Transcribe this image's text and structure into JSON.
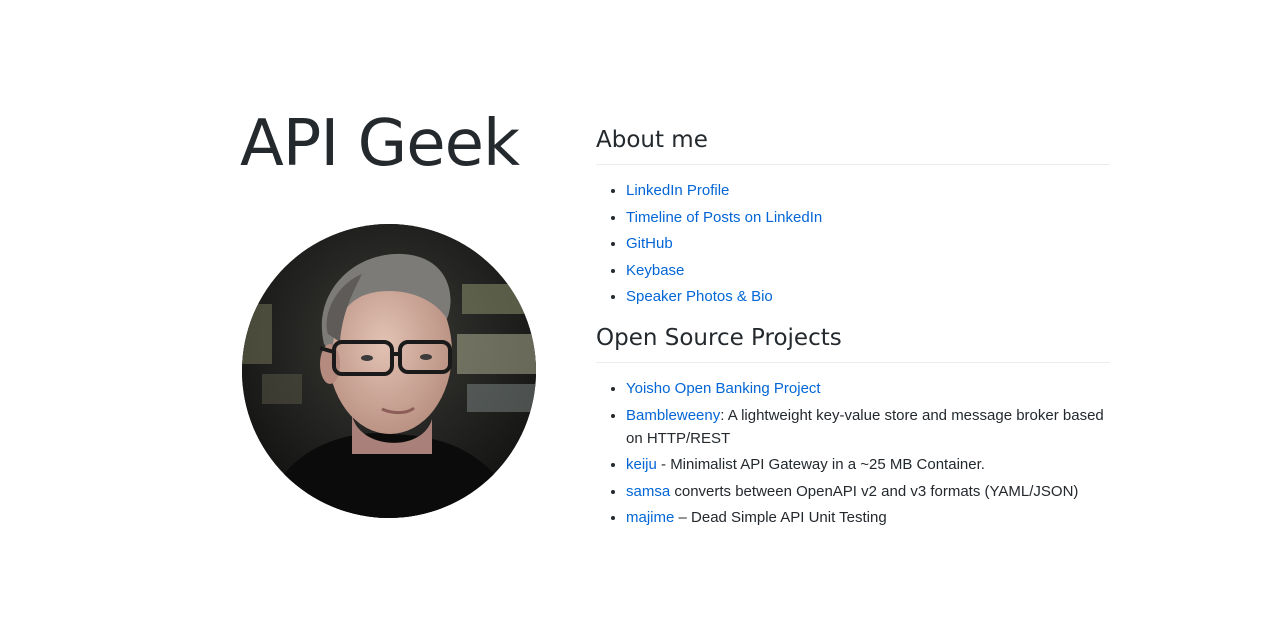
{
  "site": {
    "title": "API Geek"
  },
  "about": {
    "heading": "About me",
    "links": [
      {
        "label": "LinkedIn Profile"
      },
      {
        "label": "Timeline of Posts on LinkedIn"
      },
      {
        "label": "GitHub"
      },
      {
        "label": "Keybase"
      },
      {
        "label": "Speaker Photos & Bio"
      }
    ]
  },
  "projects": {
    "heading": "Open Source Projects",
    "items": [
      {
        "link": "Yoisho Open Banking Project",
        "desc": ""
      },
      {
        "link": "Bambleweeny",
        "desc": ": A lightweight key-value store and message broker based on HTTP/REST"
      },
      {
        "link": "keiju",
        "desc": " - Minimalist API Gateway in a ~25 MB Container."
      },
      {
        "link": "samsa",
        "desc": " converts between OpenAPI v2 and v3 formats (YAML/JSON)"
      },
      {
        "link": "majime",
        "desc": " – Dead Simple API Unit Testing"
      }
    ]
  },
  "colors": {
    "link": "#0366d6",
    "text": "#24292e",
    "rule": "#eaecef"
  },
  "avatar": {
    "icon": "portrait-photo"
  }
}
